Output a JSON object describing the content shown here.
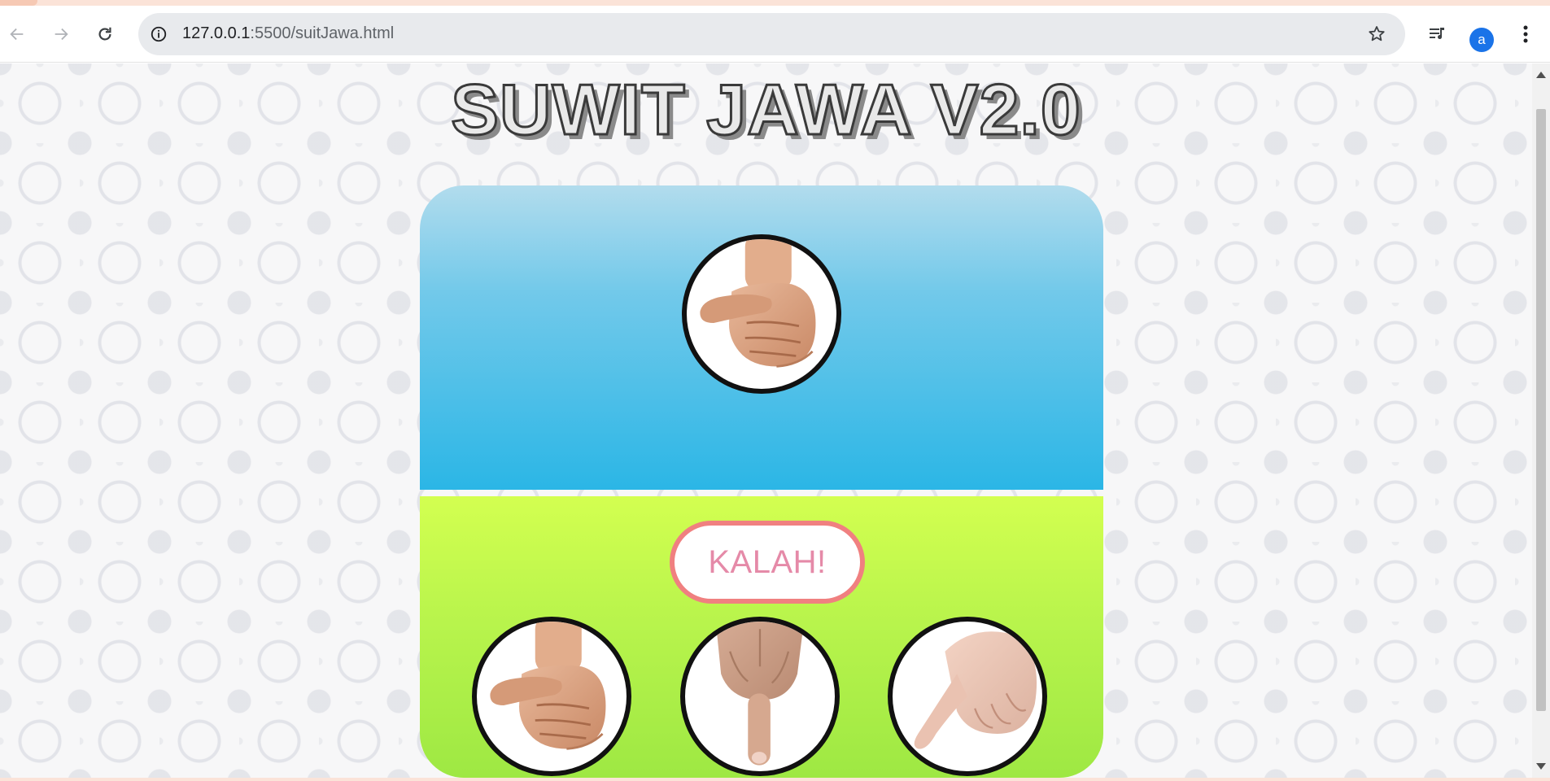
{
  "browser": {
    "url_host": "127.0.0.1",
    "url_rest": ":5500/suitJawa.html",
    "profile_initial": "a"
  },
  "game": {
    "title": "SUWIT JAWA V2.0",
    "result_text": "KALAH!",
    "computer_choice": "gajah",
    "player_options": [
      "gajah",
      "orang",
      "semut"
    ]
  },
  "colors": {
    "computer_area_top": "#b2dced",
    "computer_area_bottom": "#2bb6e6",
    "player_area_top": "#d3ff50",
    "player_area_bottom": "#9ee843",
    "result_border": "#f08080",
    "result_text": "#e58aa8"
  }
}
